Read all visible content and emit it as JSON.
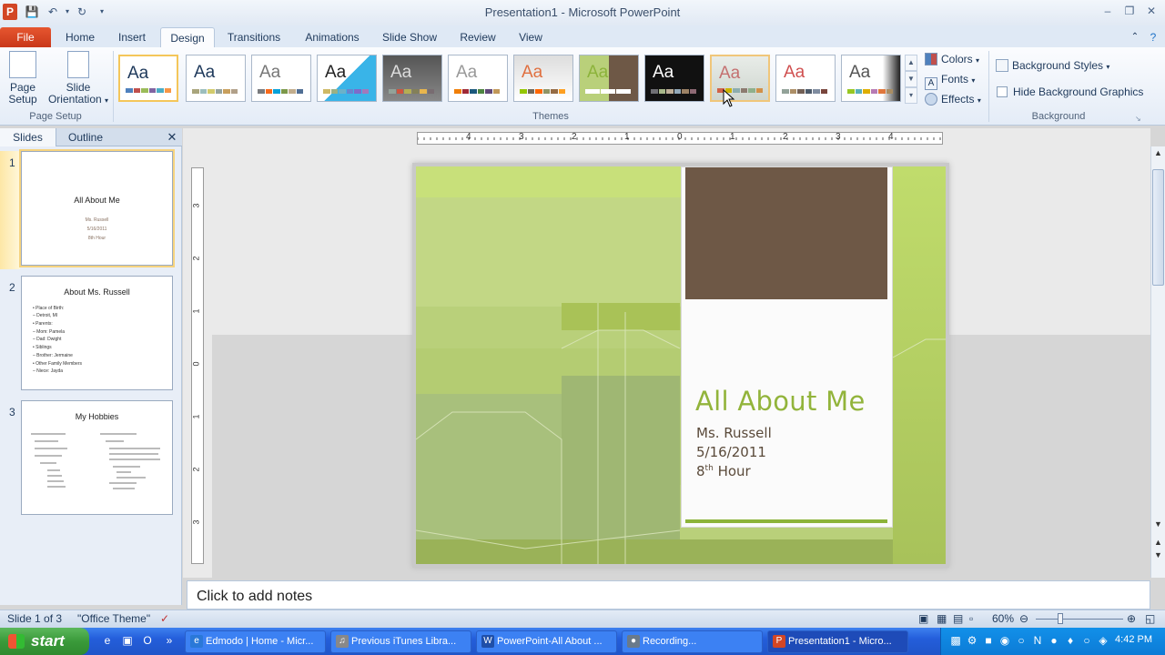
{
  "window": {
    "title": "Presentation1  -  Microsoft PowerPoint"
  },
  "tabs": [
    "File",
    "Home",
    "Insert",
    "Design",
    "Transitions",
    "Animations",
    "Slide Show",
    "Review",
    "View"
  ],
  "ribbon": {
    "page_setup": {
      "page_setup_label": "Page Setup",
      "page_setup_l1": "Page",
      "page_setup_l2": "Setup",
      "orientation_l1": "Slide",
      "orientation_l2": "Orientation",
      "group_label": "Page Setup"
    },
    "themes": {
      "group_label": "Themes",
      "sample_text": "Aa"
    },
    "theme_menu": {
      "colors": "Colors",
      "fonts": "Fonts",
      "effects": "Effects"
    },
    "background": {
      "styles": "Background Styles",
      "hide_graphics": "Hide Background Graphics",
      "group_label": "Background"
    }
  },
  "pane": {
    "tab_slides": "Slides",
    "tab_outline": "Outline",
    "slides": [
      {
        "num": "1",
        "title": "All About Me",
        "lines": [
          "Ms. Russell",
          "5/16/2011",
          "8th Hour"
        ]
      },
      {
        "num": "2",
        "title": "About Ms. Russell",
        "lines": [
          "•  Place of Birth:",
          "   – Detroit, MI",
          "•  Parents:",
          "   – Mom: Pamela",
          "   – Dad: Dwight",
          "•  Siblings",
          "   – Brother: Jermaine",
          "•  Other Family Members",
          "   – Niece: Jayda"
        ]
      },
      {
        "num": "3",
        "title": "My Hobbies"
      }
    ]
  },
  "rulers": {
    "h_labels": [
      "4",
      "3",
      "2",
      "1",
      "0",
      "1",
      "2",
      "3",
      "4"
    ],
    "v_labels": [
      "3",
      "2",
      "1",
      "0",
      "1",
      "2",
      "3"
    ]
  },
  "slide": {
    "title": "All About Me",
    "name": "Ms. Russell",
    "date": "5/16/2011",
    "hour_num": "8",
    "hour_sup": "th",
    "hour_word": "Hour"
  },
  "notes": {
    "placeholder": "Click to add notes"
  },
  "status": {
    "slide_info": "Slide 1 of 3",
    "theme": "\"Office Theme\"",
    "zoom": "60%"
  },
  "taskbar": {
    "start": "start",
    "tasks": [
      "Edmodo | Home - Micr...",
      "Previous iTunes Libra...",
      "PowerPoint-All About ...",
      "Recording...",
      "Presentation1 - Micro..."
    ],
    "clock": "4:42 PM"
  },
  "colors": {
    "accent_green": "#92b43b",
    "brown": "#6e5846",
    "file_tab": "#d24625"
  }
}
